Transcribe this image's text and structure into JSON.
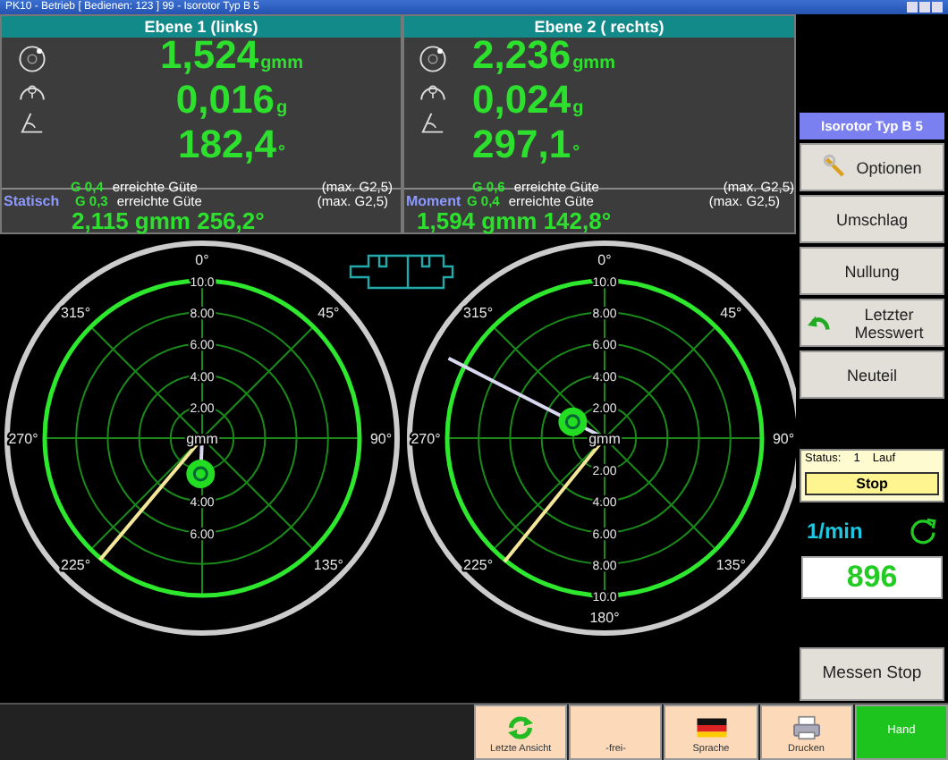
{
  "window": {
    "title": "PK10 - Betrieb [ Bedienen: 123 ] 99 - Isorotor Typ B 5"
  },
  "planes": [
    {
      "title": "Ebene 1 (links)",
      "readings": [
        {
          "kind": "unbalance",
          "value": "1,524",
          "unit": "gmm"
        },
        {
          "kind": "mass",
          "value": "0,016",
          "unit": "g"
        },
        {
          "kind": "angle",
          "value": "182,4",
          "unit": "°"
        }
      ],
      "grade": {
        "value": "G 0,4",
        "label": "erreichte Güte",
        "max": "(max. G2,5)"
      },
      "combined": {
        "label": "Statisch",
        "grade": "G 0,3",
        "grade_label": "erreichte Güte",
        "max": "(max. G2,5)",
        "value": "2,115 gmm 256,2°"
      }
    },
    {
      "title": "Ebene 2 ( rechts)",
      "readings": [
        {
          "kind": "unbalance",
          "value": "2,236",
          "unit": "gmm"
        },
        {
          "kind": "mass",
          "value": "0,024",
          "unit": "g"
        },
        {
          "kind": "angle",
          "value": "297,1",
          "unit": "°"
        }
      ],
      "grade": {
        "value": "G 0,6",
        "label": "erreichte Güte",
        "max": "(max. G2,5)"
      },
      "combined": {
        "label": "Moment",
        "grade": "G 0,4",
        "grade_label": "erreichte Güte",
        "max": "(max. G2,5)",
        "value": "1,594 gmm 142,8°"
      }
    }
  ],
  "dials": [
    {
      "center_label": "gmm",
      "angle_labels": [
        "0°",
        "45°",
        "90°",
        "135°",
        "225°",
        "270°",
        "315°"
      ],
      "ring_labels_upper": [
        "10.0",
        "8.00",
        "6.00",
        "4.00",
        "2.00"
      ],
      "ring_labels_lower": [
        "4.00",
        "6.00"
      ]
    },
    {
      "center_label": "gmm",
      "angle_labels": [
        "0°",
        "45°",
        "90°",
        "135°",
        "180°",
        "225°",
        "270°",
        "315°"
      ],
      "ring_labels_upper": [
        "10.0",
        "8.00",
        "6.00",
        "4.00",
        "2.00"
      ],
      "ring_labels_lower": [
        "2.00",
        "4.00",
        "6.00",
        "8.00",
        "10.0"
      ]
    }
  ],
  "side_panel": {
    "rotor_type": "Isorotor Typ B 5",
    "buttons": [
      {
        "label": "Optionen"
      },
      {
        "label": "Umschlag"
      },
      {
        "label": "Nullung"
      },
      {
        "label": "Letzter Messwert"
      },
      {
        "label": "Neuteil"
      }
    ],
    "status": {
      "label": "Status:",
      "count": "1",
      "state": "Lauf",
      "button": "Stop"
    },
    "speed": {
      "unit": "1/min",
      "value": "896"
    },
    "measure_stop": "Messen Stop"
  },
  "bottom_bar": [
    {
      "label": "Letzte Ansicht",
      "active": false
    },
    {
      "label": "-frei-",
      "active": false
    },
    {
      "label": "Sprache",
      "active": false
    },
    {
      "label": "Drucken",
      "active": false
    },
    {
      "label": "Hand",
      "active": true
    }
  ]
}
